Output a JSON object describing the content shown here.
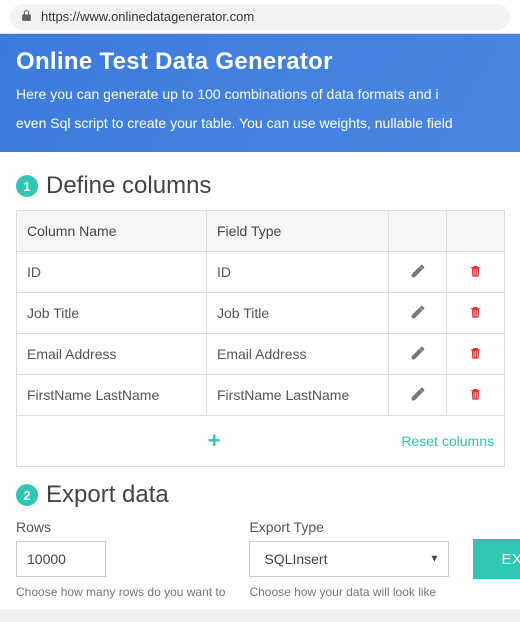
{
  "browser": {
    "url": "https://www.onlinedatagenerator.com"
  },
  "hero": {
    "title": "Online Test Data Generator",
    "subtitle_line1": "Here you can generate up to 100 combinations of data formats and i",
    "subtitle_line2": "even Sql script to create your table. You can use weights, nullable field"
  },
  "section1": {
    "step": "1",
    "title": "Define columns",
    "th_name": "Column Name",
    "th_type": "Field Type",
    "rows": [
      {
        "name": "ID",
        "type": "ID"
      },
      {
        "name": "Job Title",
        "type": "Job Title"
      },
      {
        "name": "Email Address",
        "type": "Email Address"
      },
      {
        "name": "FirstName LastName",
        "type": "FirstName LastName"
      }
    ],
    "add_symbol": "+",
    "reset_label": "Reset columns"
  },
  "section2": {
    "step": "2",
    "title": "Export data",
    "rows_label": "Rows",
    "rows_value": "10000",
    "rows_hint": "Choose how many rows do you want to",
    "type_label": "Export Type",
    "type_value": "SQLInsert",
    "type_hint": "Choose how your data will look like",
    "export_btn": "EXPORT"
  }
}
